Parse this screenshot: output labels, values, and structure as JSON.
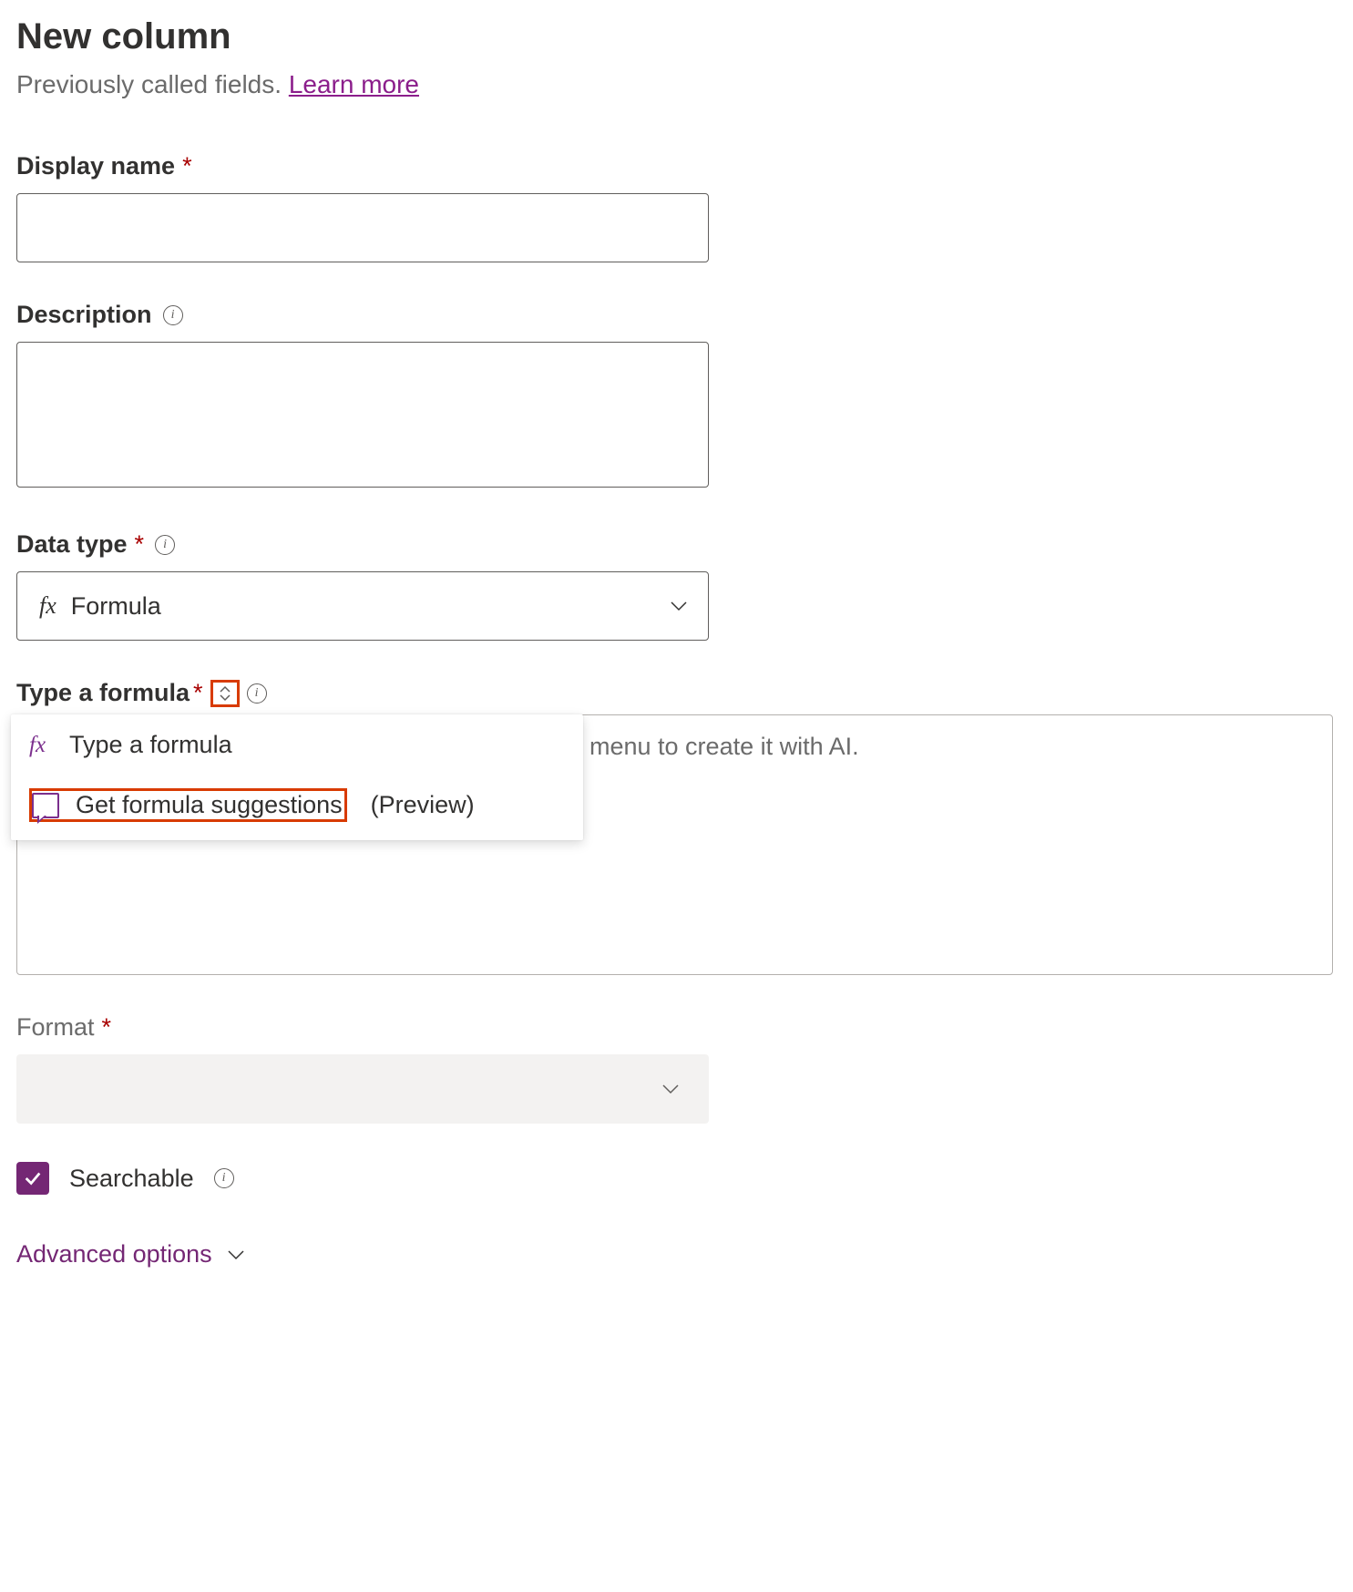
{
  "header": {
    "title": "New column",
    "subtitle_prefix": "Previously called fields. ",
    "learn_more": "Learn more"
  },
  "display_name": {
    "label": "Display name",
    "value": ""
  },
  "description": {
    "label": "Description",
    "value": ""
  },
  "data_type": {
    "label": "Data type",
    "fx_symbol": "fx",
    "value": "Formula"
  },
  "formula": {
    "label": "Type a formula",
    "placeholder_tail": "menu to create it with AI.",
    "menu": {
      "item1_fx": "fx",
      "item1_label": "Type a formula",
      "item2_label": "Get formula suggestions",
      "item2_suffix": "(Preview)"
    }
  },
  "format": {
    "label": "Format",
    "value": ""
  },
  "searchable": {
    "label": "Searchable",
    "checked": true
  },
  "advanced": {
    "label": "Advanced options"
  }
}
